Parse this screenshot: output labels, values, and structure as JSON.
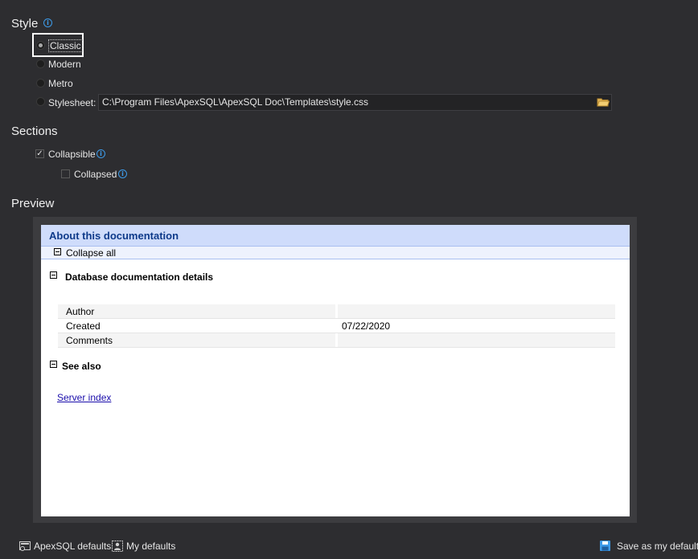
{
  "style_section": {
    "title": "Style",
    "options": {
      "classic": "Classic",
      "modern": "Modern",
      "metro": "Metro",
      "stylesheet": "Stylesheet:"
    },
    "selected": "Classic",
    "stylesheet_path": "C:\\Program Files\\ApexSQL\\ApexSQL Doc\\Templates\\style.css"
  },
  "sections_section": {
    "title": "Sections",
    "collapsible_label": "Collapsible",
    "collapsible_checked": true,
    "collapsed_label": "Collapsed",
    "collapsed_checked": false
  },
  "preview": {
    "title": "Preview",
    "header": "About this documentation",
    "collapse_all": "Collapse all",
    "details_heading": "Database documentation details",
    "rows": [
      {
        "label": "Author",
        "value": ""
      },
      {
        "label": "Created",
        "value": "07/22/2020"
      },
      {
        "label": "Comments",
        "value": ""
      }
    ],
    "see_also_heading": "See also",
    "server_index_link": "Server index"
  },
  "footer": {
    "apexsql_defaults": "ApexSQL defaults",
    "my_defaults": "My defaults",
    "save_as_my_defaults": "Save as my defaults"
  },
  "colors": {
    "background": "#2d2d30",
    "info_accent": "#3d9be9",
    "preview_header_bg": "#cfdcfb",
    "preview_header_text": "#0e3a8a",
    "link": "#1a0dab"
  }
}
